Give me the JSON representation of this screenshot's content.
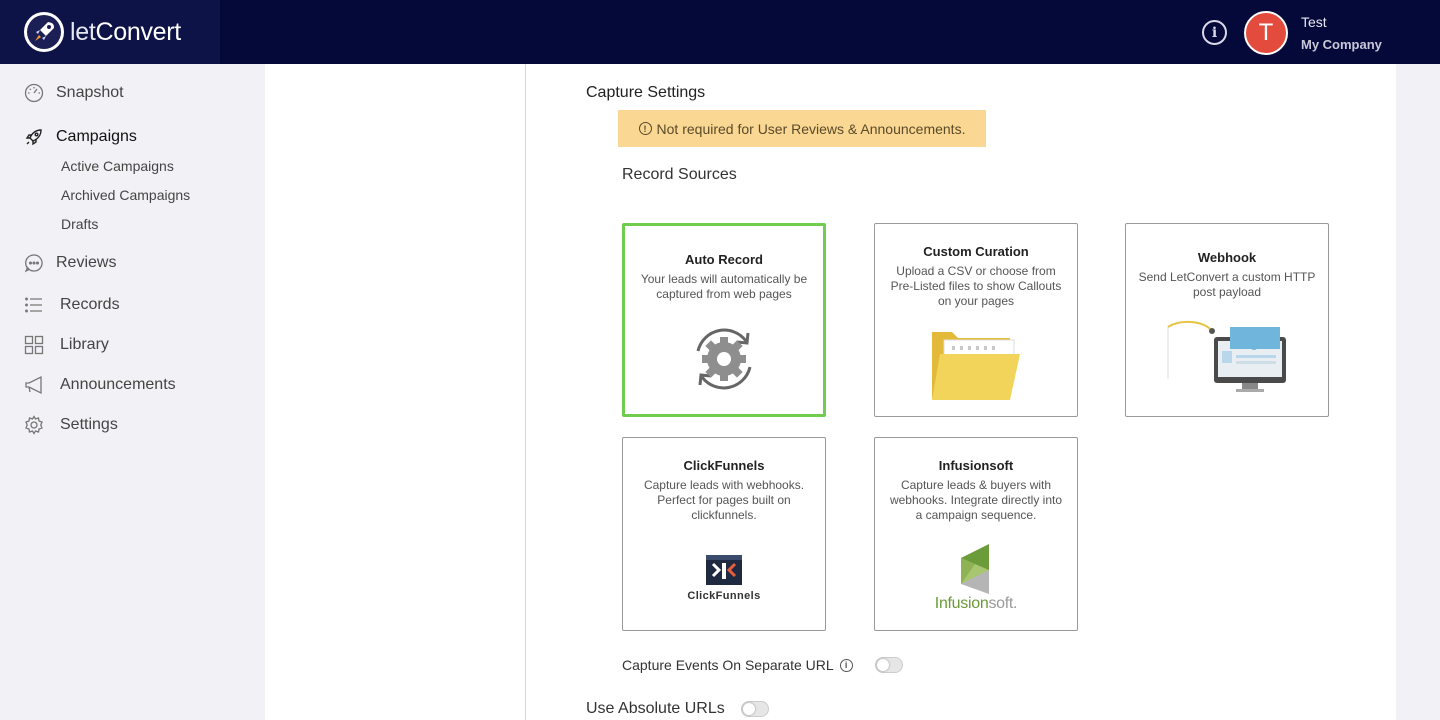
{
  "app": {
    "logo_prefix": "let",
    "logo_suffix": "Convert",
    "user_name": "Test",
    "user_company": "My Company",
    "avatar_letter": "T",
    "accent_color": "#72cc4e",
    "avatar_color": "#e34c3d",
    "topbar_color": "#05093a"
  },
  "sidebar": {
    "items": [
      {
        "label": "Snapshot",
        "icon": "gauge-icon"
      },
      {
        "label": "Campaigns",
        "icon": "rocket-icon"
      },
      {
        "label": "Reviews",
        "icon": "chat-bubble-icon"
      },
      {
        "label": "Records",
        "icon": "list-icon"
      },
      {
        "label": "Library",
        "icon": "grid-icon"
      },
      {
        "label": "Announcements",
        "icon": "megaphone-icon"
      },
      {
        "label": "Settings",
        "icon": "gear-icon"
      }
    ],
    "sub_items": [
      "Active Campaigns",
      "Archived Campaigns",
      "Drafts"
    ]
  },
  "main": {
    "section_title": "Capture Settings",
    "notice": "Not required for User Reviews & Announcements.",
    "record_sources_label": "Record Sources",
    "cards": [
      {
        "title": "Auto Record",
        "desc": "Your leads will automatically be captured from web pages",
        "selected": true,
        "icon": "sync-gear-icon"
      },
      {
        "title": "Custom Curation",
        "desc": "Upload a CSV or choose from Pre-Listed files to show Callouts on your pages",
        "selected": false,
        "icon": "folder-icon"
      },
      {
        "title": "Webhook",
        "desc": "Send LetConvert a custom HTTP post payload",
        "selected": false,
        "icon": "monitor-icon"
      },
      {
        "title": "ClickFunnels",
        "desc": "Capture leads with webhooks. Perfect for pages built on clickfunnels.",
        "selected": false,
        "icon": "clickfunnels-logo-icon",
        "logo_text": "ClickFunnels"
      },
      {
        "title": "Infusionsoft",
        "desc": "Capture leads & buyers with webhooks. Integrate directly into a campaign sequence.",
        "selected": false,
        "icon": "infusionsoft-logo-icon",
        "logo_text_a": "Infusion",
        "logo_text_b": "soft."
      }
    ],
    "toggle_separate_url": {
      "label": "Capture Events On Separate URL",
      "on": false
    },
    "toggle_absolute_urls": {
      "label": "Use Absolute URLs",
      "on": false
    }
  }
}
